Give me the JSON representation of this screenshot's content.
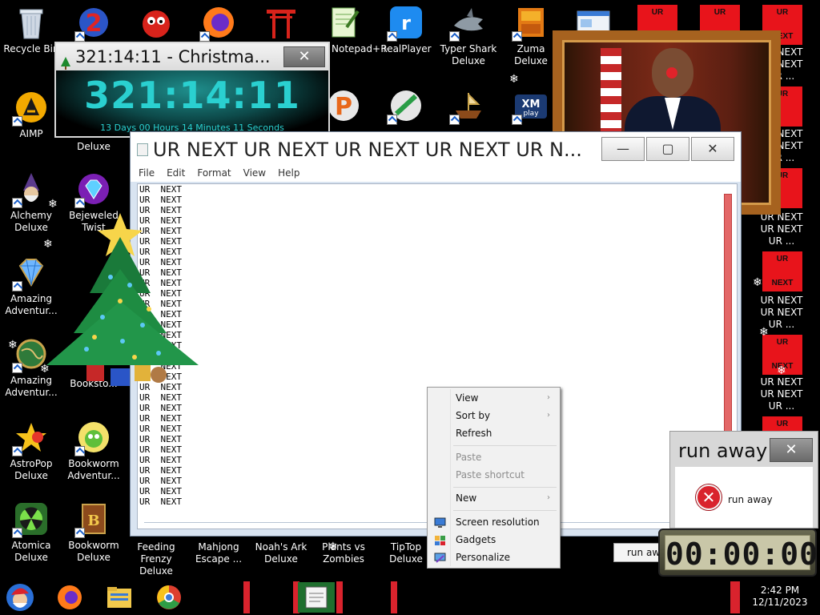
{
  "desktop": {
    "icons": {
      "recycle_bin": "Recycle Bin",
      "notepadpp": "Notepad++",
      "realplayer": "RealPlayer",
      "typer_shark": "Typer Shark Deluxe",
      "zuma": "Zuma Deluxe",
      "aimp": "AIMP",
      "deluxe_partial": "Deluxe",
      "alchemy": "Alchemy Deluxe",
      "bejeweled": "Bejeweled Twist",
      "amazing1": "Amazing Adventur...",
      "amazing2": "Amazing Adventur...",
      "bookstore": "Booksto...",
      "astropop": "AstroPop Deluxe",
      "bookworm_adv": "Bookworm Adventur...",
      "atomica": "Atomica Deluxe",
      "bookworm": "Bookworm Deluxe",
      "feeding": "Feeding Frenzy Deluxe",
      "mahjong": "Mahjong Escape ...",
      "noahs": "Noah's Ark Deluxe",
      "pvz": "Plants vs Zombies",
      "tiptop": "TipTop Deluxe"
    },
    "ur_tiles": {
      "top": "UR",
      "bottom": "NEXT",
      "label": "UR NEXT UR NEXT UR ..."
    }
  },
  "countdown": {
    "title": "321:14:11 - Christma...",
    "time": "321:14:11",
    "detail": "13 Days 00 Hours 14 Minutes 11 Seconds"
  },
  "notepad": {
    "title": "UR NEXT UR NEXT UR NEXT UR NEXT UR N...",
    "menu": [
      "File",
      "Edit",
      "Format",
      "View",
      "Help"
    ],
    "line_text": "UR  NEXT",
    "line_count": 31
  },
  "context_menu": {
    "view": "View",
    "sort_by": "Sort by",
    "refresh": "Refresh",
    "paste": "Paste",
    "paste_shortcut": "Paste shortcut",
    "new": "New",
    "screen_resolution": "Screen resolution",
    "gadgets": "Gadgets",
    "personalize": "Personalize"
  },
  "runaway": {
    "title": "run away",
    "message": "run away",
    "button": "run away"
  },
  "clock_gadget": {
    "time": "00:00:00"
  },
  "taskbar": {
    "time": "2:42 PM",
    "date": "12/11/2023"
  },
  "colors": {
    "ur_red": "#e8141b",
    "countdown_teal": "#2ad0d0",
    "accent_blue": "#1b5fc9"
  }
}
